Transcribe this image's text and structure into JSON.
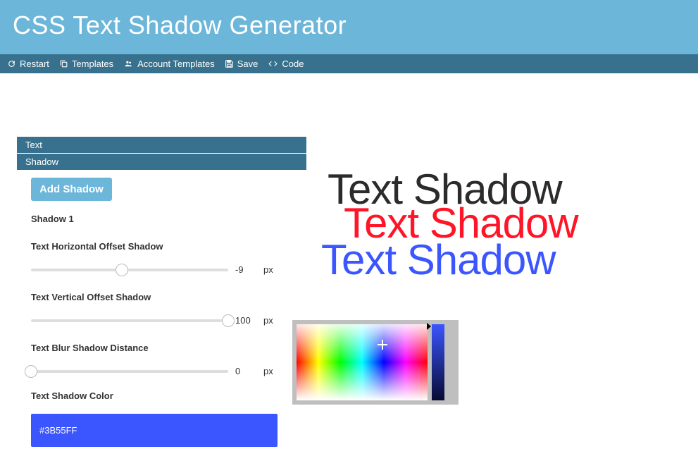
{
  "header": {
    "title": "CSS Text Shadow Generator"
  },
  "toolbar": {
    "restart": "Restart",
    "templates": "Templates",
    "account_templates": "Account Templates",
    "save": "Save",
    "code": "Code"
  },
  "tabs": {
    "text": "Text",
    "shadow": "Shadow"
  },
  "panel": {
    "add_shadow": "Add Shadow",
    "shadow_title": "Shadow 1",
    "h_offset_label": "Text Horizontal Offset Shadow",
    "h_offset_value": "-9",
    "h_offset_unit": "px",
    "h_offset_pct": 46,
    "v_offset_label": "Text Vertical Offset Shadow",
    "v_offset_value": "100",
    "v_offset_unit": "px",
    "v_offset_pct": 100,
    "blur_label": "Text Blur Shadow Distance",
    "blur_value": "0",
    "blur_unit": "px",
    "blur_pct": 0,
    "color_label": "Text Shadow Color",
    "color_value": "#3B55FF"
  },
  "preview": {
    "text": "Text Shadow"
  }
}
